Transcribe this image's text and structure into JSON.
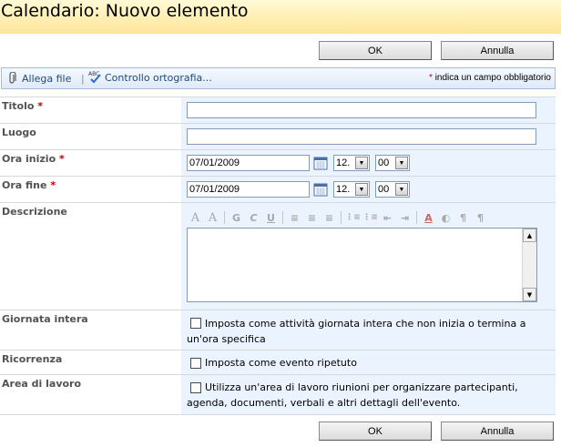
{
  "header": {
    "title": "Calendario: Nuovo elemento"
  },
  "actions": {
    "ok_label": "OK",
    "cancel_label": "Annulla"
  },
  "toolbar": {
    "attach_label": "Allega file",
    "separator": "|",
    "spellcheck_label": "Controllo ortografia...",
    "required_star": "*",
    "required_note": "indica un campo obbligatorio"
  },
  "form": {
    "required_star": "*",
    "title": {
      "label": "Titolo",
      "value": ""
    },
    "location": {
      "label": "Luogo",
      "value": ""
    },
    "start": {
      "label": "Ora inizio",
      "date": "07/01/2009",
      "hour": "12.",
      "minute": "00"
    },
    "end": {
      "label": "Ora fine",
      "date": "07/01/2009",
      "hour": "12.",
      "minute": "00"
    },
    "description": {
      "label": "Descrizione",
      "toolbar_glyphs": [
        "A",
        "A",
        "G",
        "C",
        "U",
        "≡",
        "≡",
        "≡",
        "⋮≡",
        "⋮≡",
        "⇤",
        "⇥",
        "A",
        "◐",
        "¶",
        "¶"
      ]
    },
    "all_day": {
      "label": "Giornata intera",
      "text": "Imposta come attività giornata intera che non inizia o termina a un'ora specifica",
      "checked": false
    },
    "recurrence": {
      "label": "Ricorrenza",
      "text": "Imposta come evento ripetuto",
      "checked": false
    },
    "workspace": {
      "label": "Area di lavoro",
      "text": "Utilizza un'area di lavoro riunioni per organizzare partecipanti, agenda, documenti, verbali e altri dettagli dell'evento.",
      "checked": false
    }
  },
  "icons": {
    "attach": "paperclip-icon",
    "spellcheck": "spellcheck-icon",
    "calendar": "calendar-icon",
    "dropdown": "chevron-down-icon"
  },
  "colors": {
    "title_bar": "#ffeeb0",
    "toolbar_bg": "#dfeaf8",
    "field_bg": "#ebf3ff",
    "required": "#c00000",
    "link": "#23497a"
  }
}
